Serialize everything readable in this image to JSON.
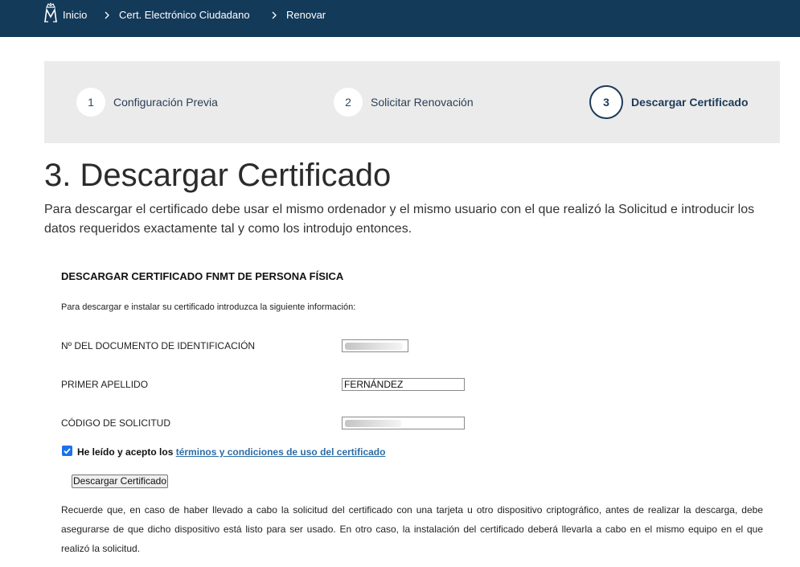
{
  "nav": {
    "breadcrumbs": [
      "Inicio",
      "Cert. Electrónico Ciudadano",
      "Renovar"
    ],
    "icons": [
      "crown-logo-icon",
      "chevron-right-icon"
    ],
    "colors": {
      "bar": "#143a5a"
    }
  },
  "steps": [
    {
      "number": "1",
      "label": "Configuración Previa"
    },
    {
      "number": "2",
      "label": "Solicitar Renovación"
    },
    {
      "number": "3",
      "label": "Descargar Certificado",
      "active": true
    }
  ],
  "page": {
    "title": "3. Descargar Certificado",
    "intro": "Para descargar el certificado debe usar el mismo ordenador y el mismo usuario con el que realizó la Solicitud e introducir los datos requeridos exactamente tal y como los introdujo entonces."
  },
  "form": {
    "title": "DESCARGAR CERTIFICADO FNMT DE PERSONA FÍSICA",
    "description": "Para descargar e instalar su certificado introduzca la siguiente información:",
    "fields": [
      {
        "label": "Nº DEL DOCUMENTO DE IDENTIFICACIÓN",
        "value": "",
        "obscured": true
      },
      {
        "label": "PRIMER APELLIDO",
        "value": "FERNÁNDEZ",
        "obscured": false
      },
      {
        "label": "CÓDIGO DE SOLICITUD",
        "value": "",
        "obscured": true
      }
    ],
    "terms": {
      "checked": true,
      "prefix": "He leído y acepto los",
      "link": "términos y condiciones de uso del certificado"
    },
    "button": "Descargar Certificado",
    "note": "Recuerde que, en caso de haber llevado a cabo la solicitud del certificado con una tarjeta u otro dispositivo criptográfico, antes de realizar la descarga, debe asegurarse de que dicho dispositivo está listo para ser usado. En otro caso, la instalación del certificado deberá llevarla a cabo en el mismo equipo en el que realizó la solicitud.",
    "colors": {
      "link": "#2e6da4",
      "checkbox": "#1a73e8"
    }
  }
}
